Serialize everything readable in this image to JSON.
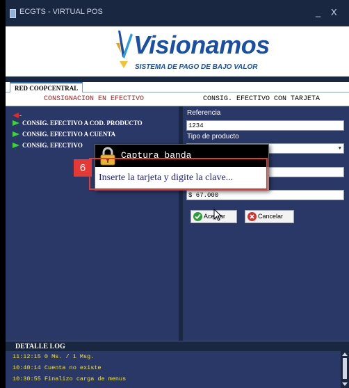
{
  "window": {
    "title": "ECGTS - VIRTUAL POS",
    "minimize_glyph": "_",
    "close_glyph": "X"
  },
  "banner": {
    "logo_name": "Visionamos",
    "logo_tagline": "SISTEMA DE PAGO DE BAJO VALOR"
  },
  "tabs": [
    {
      "label": "RED COOPCENTRAL"
    }
  ],
  "subheader": {
    "left": "CONSIGNACION EN EFECTIVO",
    "right": "CONSIG. EFECTIVO CON TARJETA"
  },
  "menu": {
    "back_text": "-",
    "items": [
      {
        "label": "CONSIG. EFECTIVO A COD. PRODUCTO"
      },
      {
        "label": "CONSIG. EFECTIVO A CUENTA"
      },
      {
        "label": "CONSIG. EFECTIVO"
      }
    ]
  },
  "form": {
    "referencia_label": "Referencia",
    "referencia_value": "1234",
    "tipo_producto_label": "Tipo de producto",
    "tipo_producto_value": "",
    "field3_value": "",
    "amount_value": "$ 67.000",
    "accept_label": "Aceptar",
    "cancel_label": "Cancelar"
  },
  "dialog": {
    "title": "Captura banda",
    "message": "Inserte la tarjeta y digite la clave..."
  },
  "annotation": {
    "step_number": "6",
    "color": "#e53935"
  },
  "log": {
    "title": "DETALLE LOG",
    "lines": [
      "11:12:15 0 Ms. / 1 Msg.",
      "10:40:14 Cuenta no existe",
      "10:30:55 Finalizo carga de menus"
    ]
  },
  "colors": {
    "panel": "#2a3868",
    "frame": "#1a2740",
    "menu_arrow": "#3bd43b",
    "back_arrow": "#e02a2a",
    "log_text": "#f3e23a",
    "brand_blue": "#1b4fa3"
  }
}
